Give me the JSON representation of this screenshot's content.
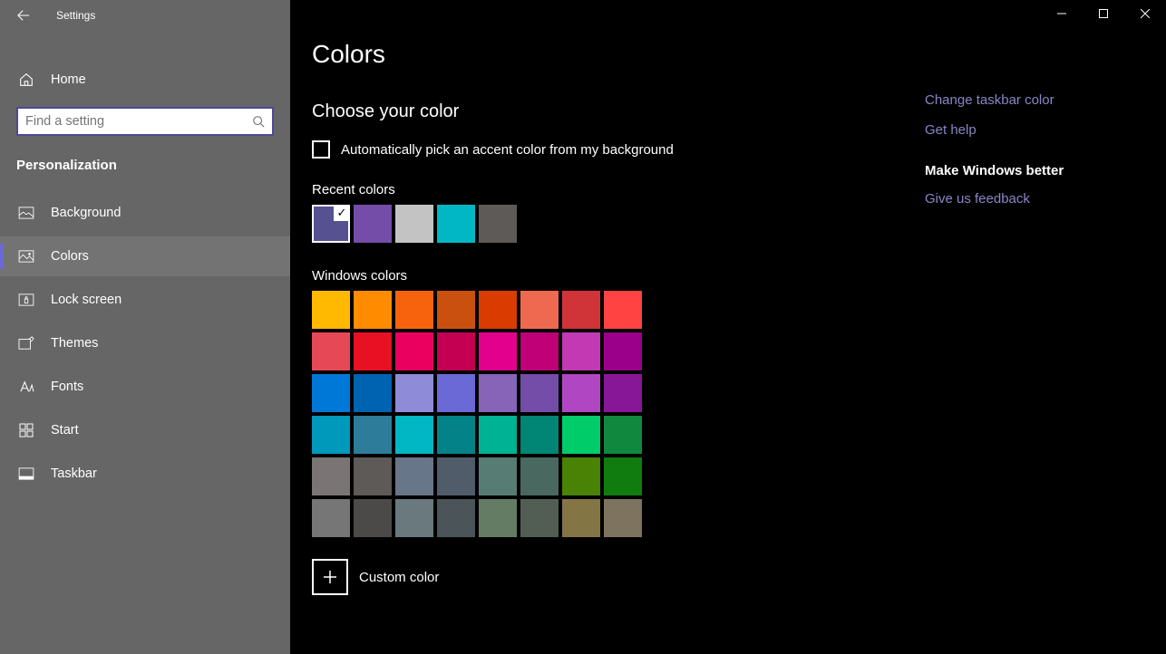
{
  "app": {
    "title": "Settings"
  },
  "sidebar": {
    "home": "Home",
    "search_placeholder": "Find a setting",
    "category": "Personalization",
    "items": [
      {
        "label": "Background"
      },
      {
        "label": "Colors"
      },
      {
        "label": "Lock screen"
      },
      {
        "label": "Themes"
      },
      {
        "label": "Fonts"
      },
      {
        "label": "Start"
      },
      {
        "label": "Taskbar"
      }
    ]
  },
  "page": {
    "title": "Colors",
    "choose_heading": "Choose your color",
    "auto_pick": "Automatically pick an accent color from my background",
    "recent_label": "Recent colors",
    "recent_colors": [
      "#565191",
      "#744da9",
      "#c3c3c3",
      "#00b7c3",
      "#5d5a58"
    ],
    "windows_label": "Windows colors",
    "windows_colors": [
      "#ffb900",
      "#ff8c00",
      "#f7630c",
      "#ca5010",
      "#da3b01",
      "#ef6950",
      "#d13438",
      "#ff4343",
      "#e74856",
      "#e81123",
      "#ea005e",
      "#c30052",
      "#e3008c",
      "#bf0077",
      "#c239b3",
      "#9a0089",
      "#0078d7",
      "#0063b1",
      "#8e8cd8",
      "#6b69d6",
      "#8764b8",
      "#744da9",
      "#b146c2",
      "#881798",
      "#0099bc",
      "#2d7d9a",
      "#00b7c3",
      "#038387",
      "#00b294",
      "#018574",
      "#00cc6a",
      "#10893e",
      "#7a7574",
      "#5d5a58",
      "#68768a",
      "#515c6b",
      "#567c73",
      "#486860",
      "#498205",
      "#107c10",
      "#767676",
      "#4c4a48",
      "#69797e",
      "#4a5459",
      "#647c64",
      "#525e54",
      "#847545",
      "#7e735f"
    ],
    "custom_label": "Custom color"
  },
  "right": {
    "link1": "Change taskbar color",
    "link2": "Get help",
    "heading": "Make Windows better",
    "link3": "Give us feedback"
  }
}
